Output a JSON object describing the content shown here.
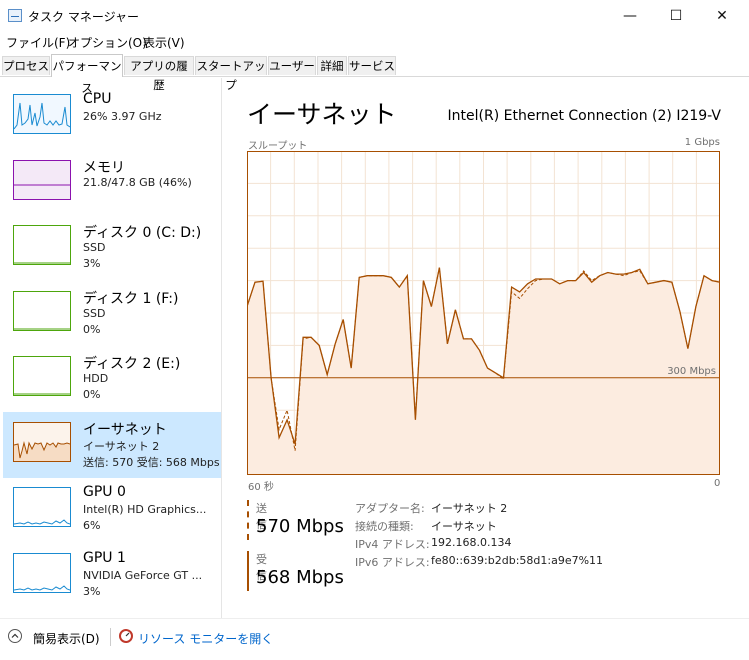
{
  "window": {
    "title": "タスク マネージャー",
    "min": "—",
    "max": "☐",
    "close": "✕"
  },
  "menu": [
    "ファイル(F)",
    "オプション(O)",
    "表示(V)"
  ],
  "tabs": [
    "プロセス",
    "パフォーマンス",
    "アプリの履歴",
    "スタートアップ",
    "ユーザー",
    "詳細",
    "サービス"
  ],
  "active_tab": 1,
  "sidebar": [
    {
      "name": "CPU",
      "l1": "26%  3.97 GHz",
      "l2": "",
      "color": "#1a8bd1",
      "fill": "#f1f8ff",
      "icon": "cpu-graph"
    },
    {
      "name": "メモリ",
      "l1": "21.8/47.8 GB (46%)",
      "l2": "",
      "color": "#8b12ae",
      "fill": "#f4e9f7",
      "icon": "memory-graph"
    },
    {
      "name": "ディスク 0 (C: D:)",
      "l1": "SSD",
      "l2": "3%",
      "color": "#4da60c",
      "fill": "#ffffff",
      "icon": "disk-graph"
    },
    {
      "name": "ディスク 1 (F:)",
      "l1": "SSD",
      "l2": "0%",
      "color": "#4da60c",
      "fill": "#ffffff",
      "icon": "disk-graph"
    },
    {
      "name": "ディスク 2 (E:)",
      "l1": "HDD",
      "l2": "0%",
      "color": "#4da60c",
      "fill": "#ffffff",
      "icon": "disk-graph"
    },
    {
      "name": "イーサネット",
      "l1": "イーサネット 2",
      "l2": "送信: 570 受信: 568 Mbps",
      "color": "#a74f01",
      "fill": "#fcf3eb",
      "icon": "ethernet-graph"
    },
    {
      "name": "GPU 0",
      "l1": "Intel(R) HD Graphics...",
      "l2": "6%",
      "color": "#1a8bd1",
      "fill": "#ffffff",
      "icon": "gpu-graph"
    },
    {
      "name": "GPU 1",
      "l1": "NVIDIA GeForce GT ...",
      "l2": "3%",
      "color": "#1a8bd1",
      "fill": "#ffffff",
      "icon": "gpu-graph"
    }
  ],
  "selected_index": 5,
  "main": {
    "title": "イーサネット",
    "adapter": "Intel(R) Ethernet Connection (2) I219-V",
    "throughput_label": "スループット",
    "max_label": "1 Gbps",
    "mid_label": "300 Mbps",
    "x_left": "60 秒",
    "x_right": "0",
    "accent": "#a74f01",
    "send": {
      "label": "送信",
      "value": "570 Mbps"
    },
    "recv": {
      "label": "受信",
      "value": "568 Mbps"
    },
    "details": [
      {
        "k": "アダプター名:",
        "v": "イーサネット 2"
      },
      {
        "k": "接続の種類:",
        "v": "イーサネット"
      },
      {
        "k": "IPv4 アドレス:",
        "v": "192.168.0.134"
      },
      {
        "k": "IPv6 アドレス:",
        "v": "fe80::639:b2db:58d1:a9e7%11"
      }
    ]
  },
  "footer": {
    "fewer_details": "簡易表示(D)",
    "resource_monitor": "リソース モニターを開く"
  },
  "chart_data": {
    "type": "line",
    "title": "スループット",
    "ylim": [
      0,
      1000
    ],
    "y_unit": "Mbps",
    "x_range_seconds": [
      60,
      0
    ],
    "grid": true,
    "reference_line": 300,
    "series": [
      {
        "name": "受信",
        "style": "solid",
        "values": [
          520,
          595,
          598,
          300,
          115,
          170,
          95,
          425,
          425,
          400,
          310,
          405,
          480,
          330,
          610,
          615,
          615,
          615,
          610,
          580,
          615,
          170,
          600,
          520,
          640,
          405,
          510,
          420,
          420,
          385,
          330,
          315,
          300,
          580,
          565,
          590,
          605,
          605,
          605,
          590,
          600,
          600,
          625,
          595,
          615,
          625,
          620,
          620,
          625,
          635,
          590,
          595,
          600,
          595,
          505,
          390,
          520,
          615,
          600,
          595
        ]
      },
      {
        "name": "送信",
        "style": "dashed",
        "values": [
          520,
          595,
          598,
          300,
          140,
          200,
          75,
          420,
          425,
          400,
          310,
          405,
          480,
          330,
          610,
          615,
          615,
          615,
          610,
          580,
          615,
          175,
          600,
          520,
          640,
          405,
          510,
          420,
          420,
          385,
          330,
          315,
          295,
          565,
          545,
          575,
          600,
          605,
          605,
          590,
          600,
          600,
          630,
          600,
          615,
          625,
          620,
          615,
          625,
          630,
          590,
          595,
          600,
          595,
          505,
          390,
          520,
          615,
          600,
          595
        ]
      }
    ]
  }
}
